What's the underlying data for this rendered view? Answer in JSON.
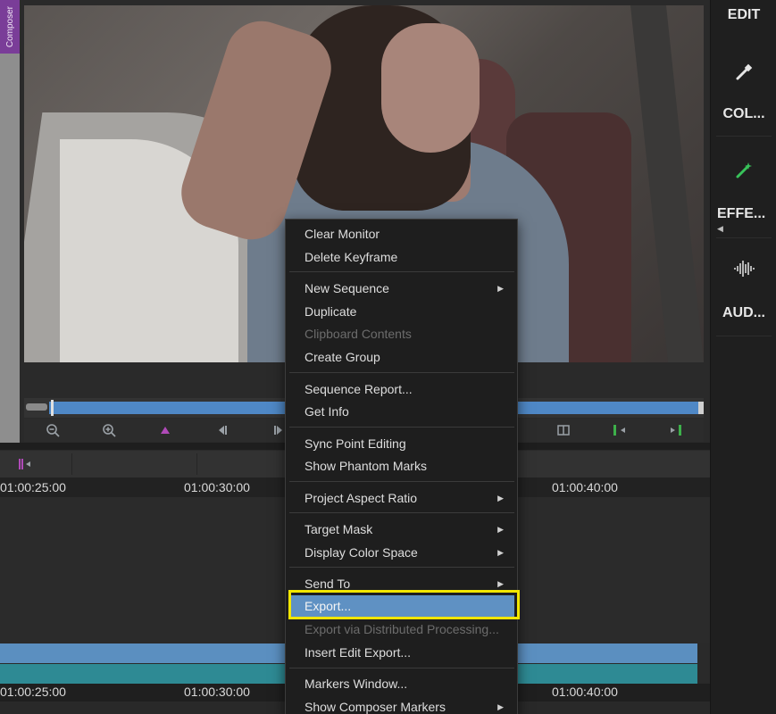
{
  "composer_tab": {
    "label": "Composer"
  },
  "right_panel": {
    "edit_label": "EDIT",
    "color_label": "COL...",
    "effects_label": "EFFE...",
    "audio_label": "AUD..."
  },
  "timeline": {
    "ruler_top": [
      "01:00:25:00",
      "01:00:30:00",
      "01:00:40:00"
    ],
    "ruler_bottom": [
      "01:00:25:00",
      "01:00:30:00",
      "01:00:40:00"
    ]
  },
  "menu": {
    "items": [
      {
        "label": "Clear Monitor"
      },
      {
        "label": "Delete Keyframe"
      },
      {
        "label": "New Sequence",
        "submenu": true
      },
      {
        "label": "Duplicate"
      },
      {
        "label": "Clipboard Contents",
        "disabled": true
      },
      {
        "label": "Create Group"
      },
      {
        "label": "Sequence Report..."
      },
      {
        "label": "Get Info"
      },
      {
        "label": "Sync Point Editing"
      },
      {
        "label": "Show Phantom Marks"
      },
      {
        "label": "Project Aspect Ratio",
        "submenu": true
      },
      {
        "label": "Target Mask",
        "submenu": true
      },
      {
        "label": "Display Color Space",
        "submenu": true
      },
      {
        "label": "Send To",
        "submenu": true
      },
      {
        "label": "Export...",
        "highlighted": true
      },
      {
        "label": "Export via Distributed Processing...",
        "disabled": true
      },
      {
        "label": "Insert Edit Export..."
      },
      {
        "label": "Markers Window..."
      },
      {
        "label": "Show Composer Markers",
        "submenu": true
      }
    ],
    "submenu_glyph": "▶"
  },
  "colors": {
    "accent_blue": "#5f91c3",
    "highlight_ring": "#f2e600",
    "composer_purple": "#7a3d98",
    "track_blue": "#5b8fc0",
    "track_teal": "#2e8a94"
  }
}
